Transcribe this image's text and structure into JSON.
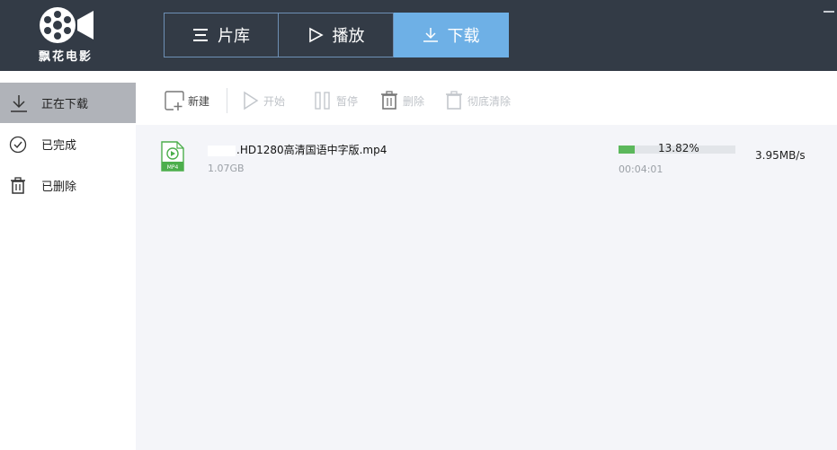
{
  "app": {
    "name": "飘花电影"
  },
  "tabs": [
    {
      "label": "片库",
      "icon": "list-icon"
    },
    {
      "label": "播放",
      "icon": "play-icon"
    },
    {
      "label": "下载",
      "icon": "download-icon",
      "active": true
    }
  ],
  "sidebar": {
    "items": [
      {
        "label": "正在下载",
        "icon": "download-icon",
        "active": true
      },
      {
        "label": "已完成",
        "icon": "check-circle-icon"
      },
      {
        "label": "已删除",
        "icon": "trash-icon"
      }
    ]
  },
  "toolbar": {
    "new_label": "新建",
    "start_label": "开始",
    "pause_label": "暂停",
    "delete_label": "删除",
    "purge_label": "彻底清除"
  },
  "downloads": [
    {
      "file_name": ".HD1280高清国语中字版.mp4",
      "file_type": "MP4",
      "size": "1.07GB",
      "progress_text": "13.82%",
      "progress": 0.1382,
      "elapsed": "00:04:01",
      "speed": "3.95MB/s"
    }
  ],
  "colors": {
    "header_bg": "#333b46",
    "active_tab": "#6eb0e6",
    "progress_fill": "#5cb85c",
    "sidebar_active": "#b0b3b9"
  }
}
